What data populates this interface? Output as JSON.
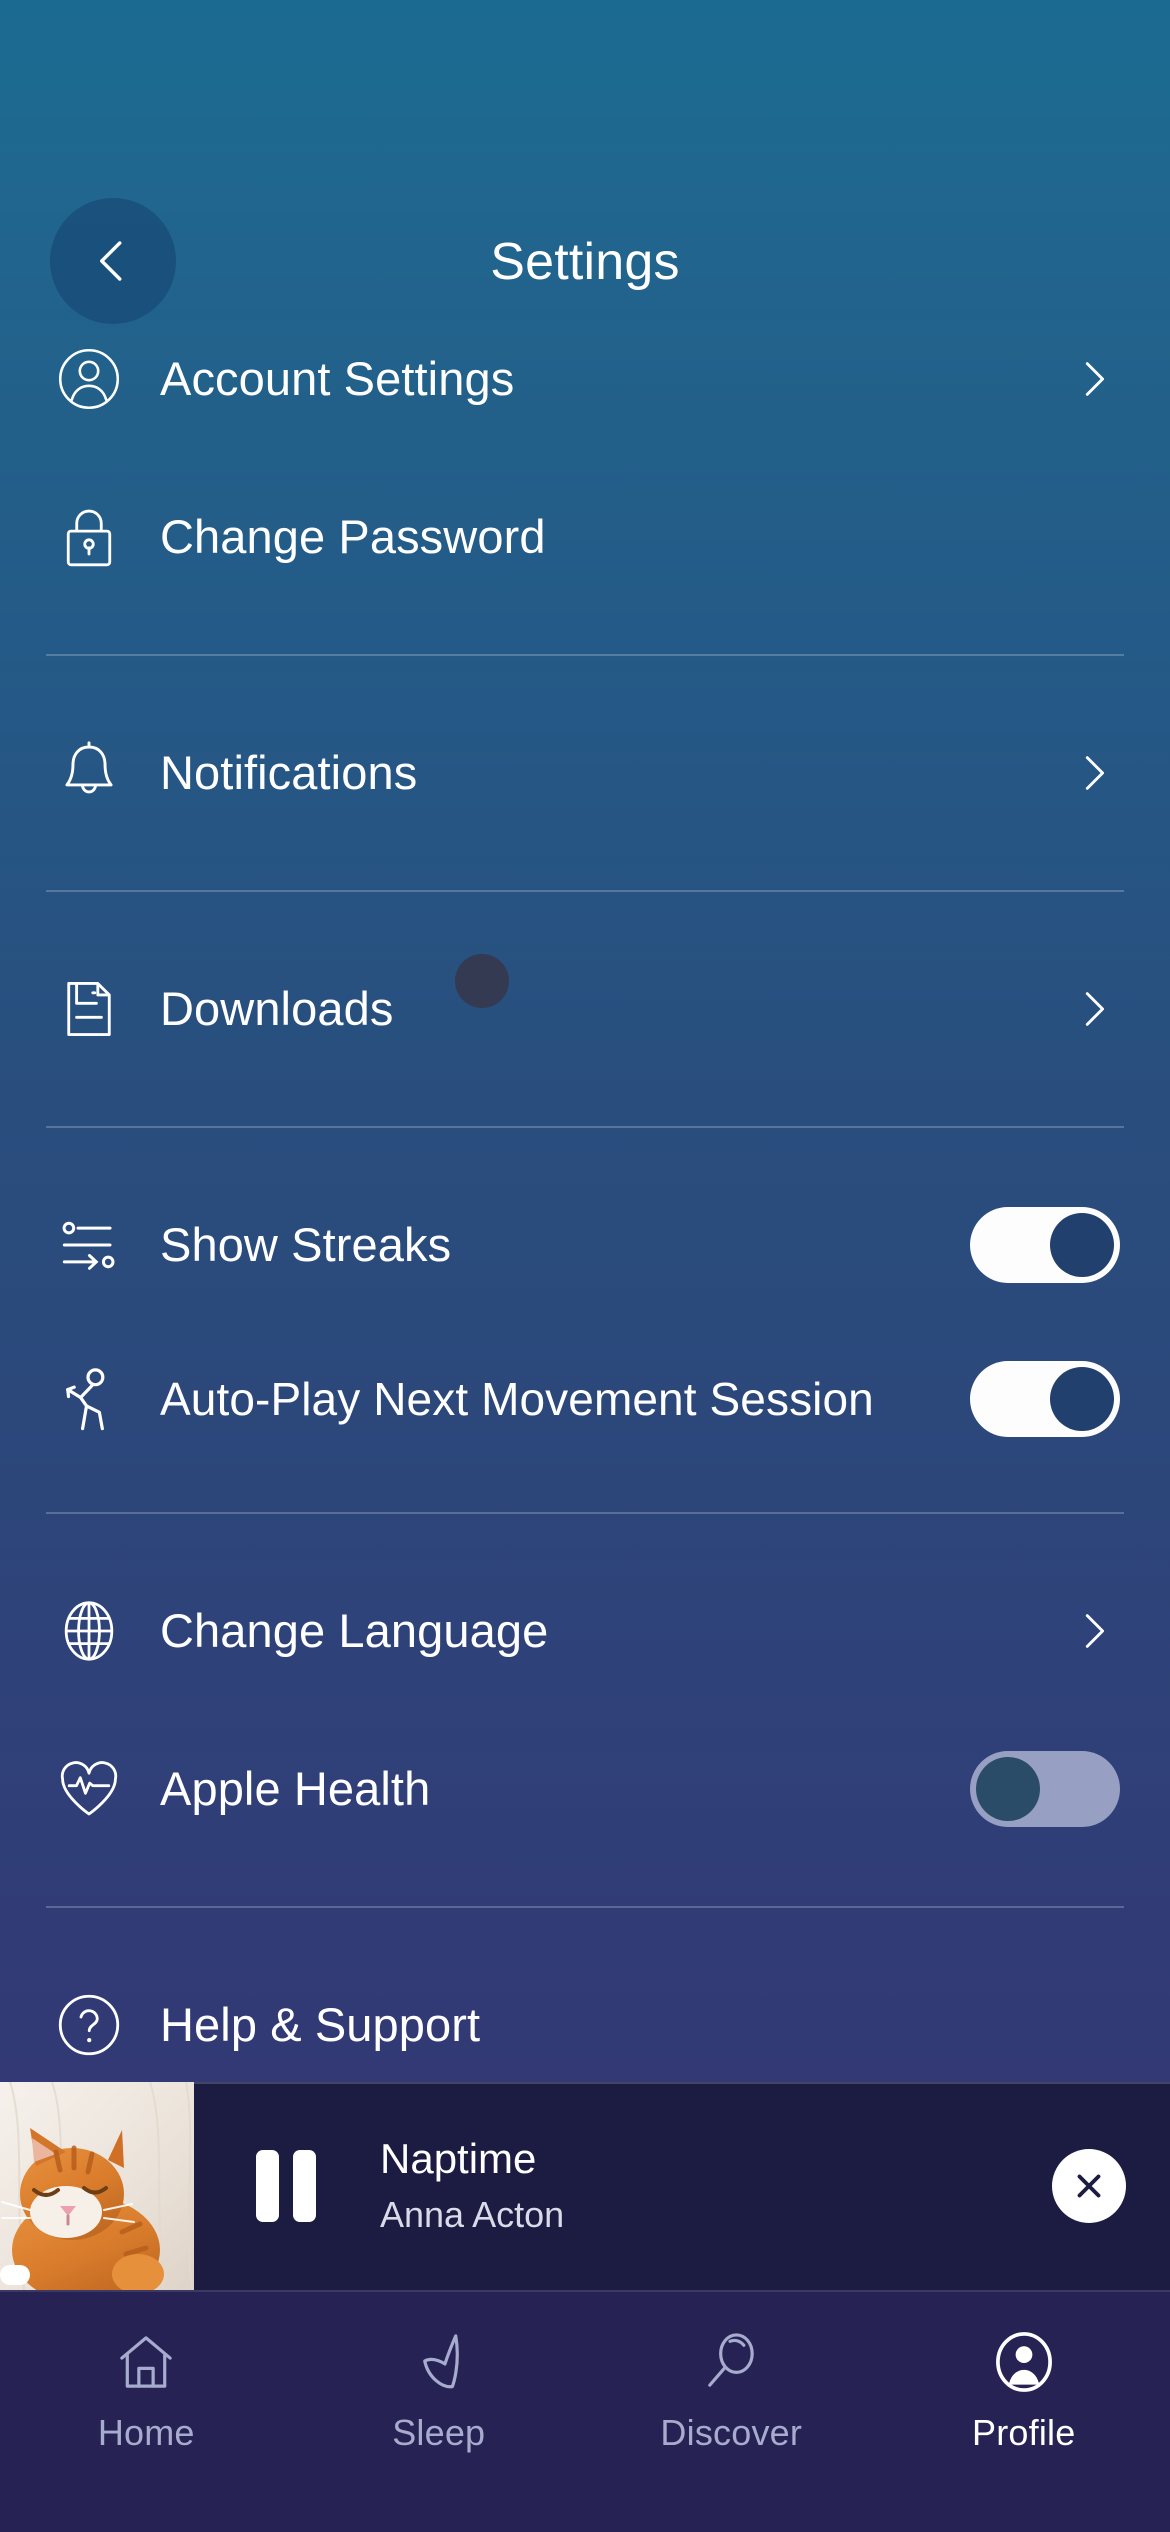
{
  "header": {
    "title": "Settings",
    "back_icon": "chevron-left-icon"
  },
  "colors": {
    "gradient_top": "#1b6a92",
    "gradient_bottom": "#342f71",
    "toggle_on_track": "#fdfdfd",
    "toggle_on_knob": "#21406e",
    "toggle_off_track": "#97a0c2",
    "toggle_off_knob": "#2b4c68",
    "player_background": "#1c1b42",
    "tabbar_background": "#262354",
    "badge_dot": "#343a52",
    "text_primary": "#ffffff",
    "tab_inactive": "#a7abcd"
  },
  "settings_groups": [
    {
      "rows": [
        {
          "label": "Account Settings",
          "icon": "user-circle-icon",
          "accessory": "chevron"
        },
        {
          "label": "Change Password",
          "icon": "lock-icon",
          "accessory": "none"
        }
      ]
    },
    {
      "rows": [
        {
          "label": "Notifications",
          "icon": "bell-icon",
          "accessory": "chevron"
        }
      ]
    },
    {
      "rows": [
        {
          "label": "Downloads",
          "icon": "document-download-icon",
          "accessory": "chevron",
          "badge": true
        }
      ]
    },
    {
      "rows": [
        {
          "label": "Show Streaks",
          "icon": "sliders-icon",
          "accessory": "toggle",
          "toggle_state": "on"
        },
        {
          "label": "Auto-Play Next Movement Session",
          "icon": "stretching-person-icon",
          "accessory": "toggle",
          "toggle_state": "on"
        }
      ]
    },
    {
      "rows": [
        {
          "label": "Change Language",
          "icon": "globe-icon",
          "accessory": "chevron"
        },
        {
          "label": "Apple Health",
          "icon": "heart-pulse-icon",
          "accessory": "toggle",
          "toggle_state": "off"
        }
      ]
    },
    {
      "rows": [
        {
          "label": "Help & Support",
          "icon": "question-circle-icon",
          "accessory": "none"
        }
      ]
    }
  ],
  "player": {
    "title": "Naptime",
    "artist": "Anna Acton",
    "pause_icon": "pause-icon",
    "close_icon": "close-x-icon",
    "artwork_alt": "sleeping-orange-kitten"
  },
  "tabbar": {
    "items": [
      {
        "label": "Home",
        "icon": "home-icon",
        "active": false
      },
      {
        "label": "Sleep",
        "icon": "moon-icon",
        "active": false
      },
      {
        "label": "Discover",
        "icon": "search-icon",
        "active": false
      },
      {
        "label": "Profile",
        "icon": "profile-avatar-icon",
        "active": true
      }
    ]
  }
}
